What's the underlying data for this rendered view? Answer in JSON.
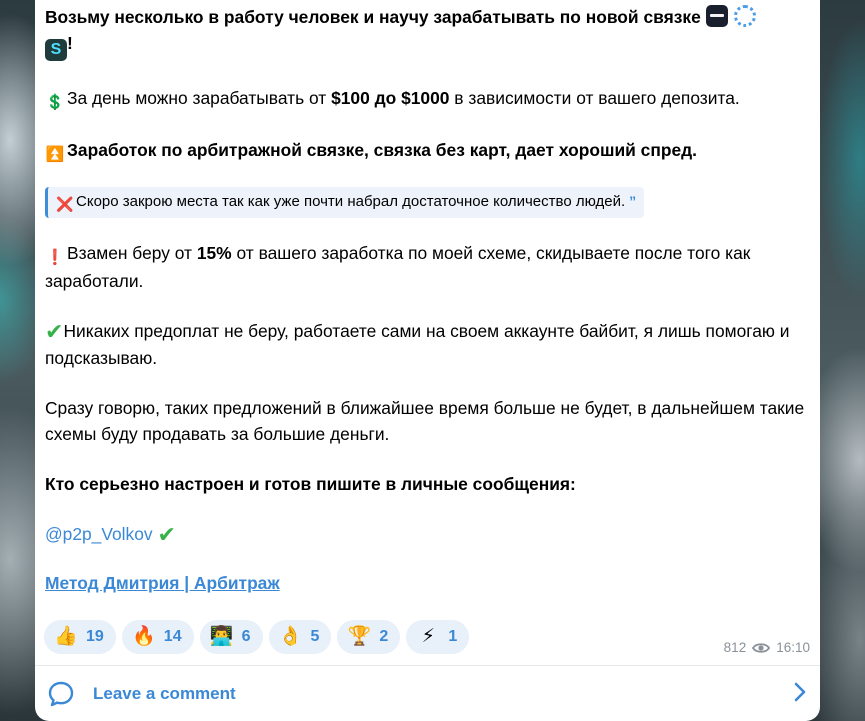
{
  "message": {
    "line1": "Возьму несколько в работу человек и научу зарабатывать по новой связке",
    "line1_end": "!",
    "p2_a": "За день можно зарабатывать от ",
    "p2_bold": "$100 до $1000",
    "p2_b": " в зависимости от вашего депозита.",
    "p3_bold": "Заработок по арбитражной связке, связка без карт, дает хороший спред.",
    "quote": "Скоро закрою места так как уже почти набрал достаточное количество людей.",
    "p5_a": "Взамен беру от ",
    "p5_bold": "15%",
    "p5_b": " от вашего заработка по моей схеме, скидываете после того как заработали.",
    "p6": "Никаких предоплат не беру, работаете сами на своем аккаунте байбит, я лишь помогаю и подсказываю.",
    "p7": "Сразу говорю, таких предложений в ближайшее время больше не будет, в дальнейшем такие схемы буду продавать за большие деньги.",
    "p8_bold": "Кто серьезно настроен и готов пишите в личные сообщения:",
    "mention": "@p2p_Volkov",
    "channel_link": "Метод Дмитрия | Арбитраж"
  },
  "emojis": {
    "money": "💲",
    "arrows": "⏫",
    "cross": "❌",
    "exclamation": "❗",
    "check": "✔"
  },
  "reactions": [
    {
      "icon": "👍",
      "name": "thumbs-up-icon",
      "count": "19"
    },
    {
      "icon": "🔥",
      "name": "fire-icon",
      "count": "14"
    },
    {
      "icon": "👨‍💻",
      "name": "technologist-icon",
      "count": "6"
    },
    {
      "icon": "👌",
      "name": "ok-hand-icon",
      "count": "5"
    },
    {
      "icon": "🏆",
      "name": "trophy-icon",
      "count": "2"
    },
    {
      "icon": "⚡",
      "name": "lightning-icon",
      "count": "1"
    }
  ],
  "meta": {
    "views": "812",
    "time": "16:10"
  },
  "comment": {
    "label": "Leave a comment"
  },
  "colors": {
    "accent": "#3a88d6",
    "check_green": "#37b14a",
    "quote_bg": "#eef3fb"
  }
}
